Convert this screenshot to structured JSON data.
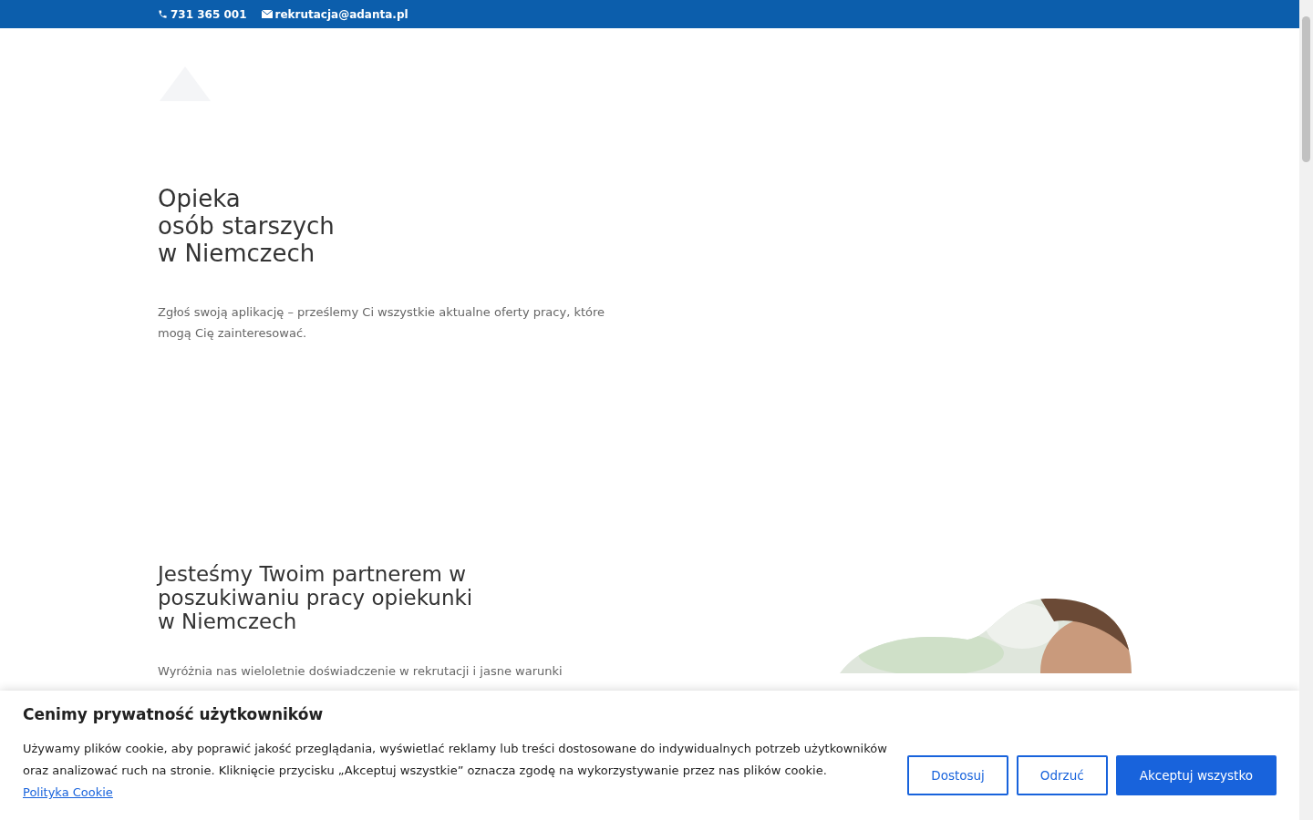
{
  "top_bar": {
    "phone": "731 365 001",
    "email": "rekrutacja@adanta.pl"
  },
  "hero": {
    "title_lines": [
      "Opieka",
      "osób starszych",
      "w Niemczech"
    ],
    "text": "Zgłoś swoją aplikację – prześlemy Ci wszystkie aktualne oferty pracy, które mogą Cię zainteresować."
  },
  "partner": {
    "title_lines": [
      "Jesteśmy Twoim partnerem w",
      "poszukiwaniu pracy opiekunki",
      "w Niemczech"
    ],
    "text": "Wyróżnia nas wieloletnie doświadczenie w rekrutacji i jasne warunki"
  },
  "cookie_banner": {
    "title": "Cenimy prywatność użytkowników",
    "text": "Używamy plików cookie, aby poprawić jakość przeglądania, wyświetlać reklamy lub treści dostosowane do indywidualnych potrzeb użytkowników oraz analizować ruch na stronie. Kliknięcie przycisku „Akceptuj wszystkie” oznacza zgodę na wykorzystywanie przez nas plików cookie.",
    "link": "Polityka Cookie",
    "buttons": [
      {
        "label": "Dostosuj",
        "kind": "outline"
      },
      {
        "label": "Odrzuć",
        "kind": "outline"
      },
      {
        "label": "Akceptuj wszystko",
        "kind": "primary"
      }
    ]
  }
}
